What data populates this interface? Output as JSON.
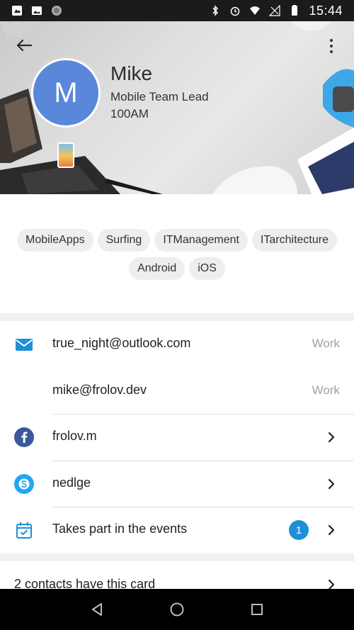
{
  "status_bar": {
    "time": "15:44"
  },
  "profile": {
    "initial": "M",
    "name": "Mike",
    "job_title": "Mobile Team Lead",
    "company": "100AM"
  },
  "tags": [
    "MobileApps",
    "Surfing",
    "ITManagement",
    "ITarchitecture",
    "Android",
    "iOS"
  ],
  "contacts": {
    "email_primary": {
      "value": "true_night@outlook.com",
      "type": "Work"
    },
    "email_secondary": {
      "value": "mike@frolov.dev",
      "type": "Work"
    },
    "facebook": {
      "value": "frolov.m"
    },
    "skype": {
      "value": "nedlge"
    },
    "events": {
      "label": "Takes part in the events",
      "count": "1"
    }
  },
  "shared_contacts": {
    "label": "2 contacts have this card"
  },
  "colors": {
    "avatar": "#5a87d9",
    "accent_blue": "#1f8fd8",
    "facebook": "#3b5998",
    "skype": "#1fa8ef"
  },
  "icons": {
    "back": "arrow-left-icon",
    "more": "more-vertical-icon",
    "email": "envelope-icon",
    "facebook": "facebook-icon",
    "skype": "skype-icon",
    "events": "calendar-check-icon"
  }
}
